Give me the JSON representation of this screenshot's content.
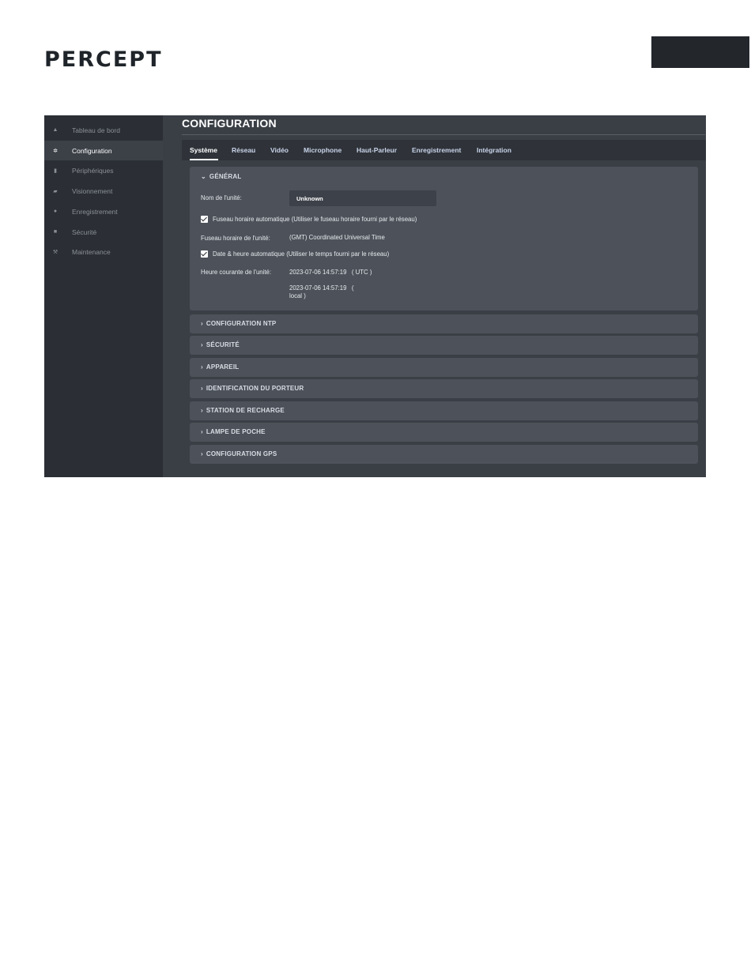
{
  "logo": {
    "text": "PERCEPT"
  },
  "sidebar": {
    "items": [
      {
        "label": "Tableau de bord",
        "icon": "home-icon",
        "glyph": "▲"
      },
      {
        "label": "Configuration",
        "icon": "gear-icon",
        "glyph": "✲"
      },
      {
        "label": "Périphériques",
        "icon": "device-icon",
        "glyph": "▮"
      },
      {
        "label": "Visionnement",
        "icon": "camera-icon",
        "glyph": "▰"
      },
      {
        "label": "Enregistrement",
        "icon": "record-icon",
        "glyph": "●"
      },
      {
        "label": "Sécurité",
        "icon": "lock-icon",
        "glyph": "■"
      },
      {
        "label": "Maintenance",
        "icon": "wrench-icon",
        "glyph": "⚒"
      }
    ],
    "active_index": 1
  },
  "main": {
    "title": "CONFIGURATION",
    "tabs": [
      {
        "label": "Système"
      },
      {
        "label": "Réseau"
      },
      {
        "label": "Vidéo"
      },
      {
        "label": "Microphone"
      },
      {
        "label": "Haut-Parleur"
      },
      {
        "label": "Enregistrement"
      },
      {
        "label": "Intégration"
      }
    ],
    "active_tab": 0
  },
  "general": {
    "header": "GÉNÉRAL",
    "unit_name_label": "Nom de l'unité:",
    "unit_name_value": "Unknown",
    "auto_tz_label": "Fuseau horaire automatique (Utiliser le fuseau horaire fourni par le réseau)",
    "auto_tz_checked": true,
    "tz_label": "Fuseau horaire de l'unité:",
    "tz_value": "(GMT) Coordinated Universal Time",
    "auto_dt_label": "Date & heure automatique (Utiliser le temps fourni par le réseau)",
    "auto_dt_checked": true,
    "current_time_label": "Heure courante de l'unité:",
    "utc_time": "2023-07-06 14:57:19   ( UTC )",
    "local_time_line1": "2023-07-06 14:57:19   (",
    "local_time_line2": "local )"
  },
  "collapsed_sections": [
    "CONFIGURATION NTP",
    "SÉCURITÉ",
    "APPAREIL",
    "IDENTIFICATION DU PORTEUR",
    "STATION DE RECHARGE",
    "LAMPE DE POCHE",
    "CONFIGURATION GPS"
  ],
  "colors": {
    "sidebar_bg": "#2b2f35",
    "main_bg": "#3a3f46",
    "section_bg": "#4d525a",
    "accent_teal": "#2a8a95"
  }
}
